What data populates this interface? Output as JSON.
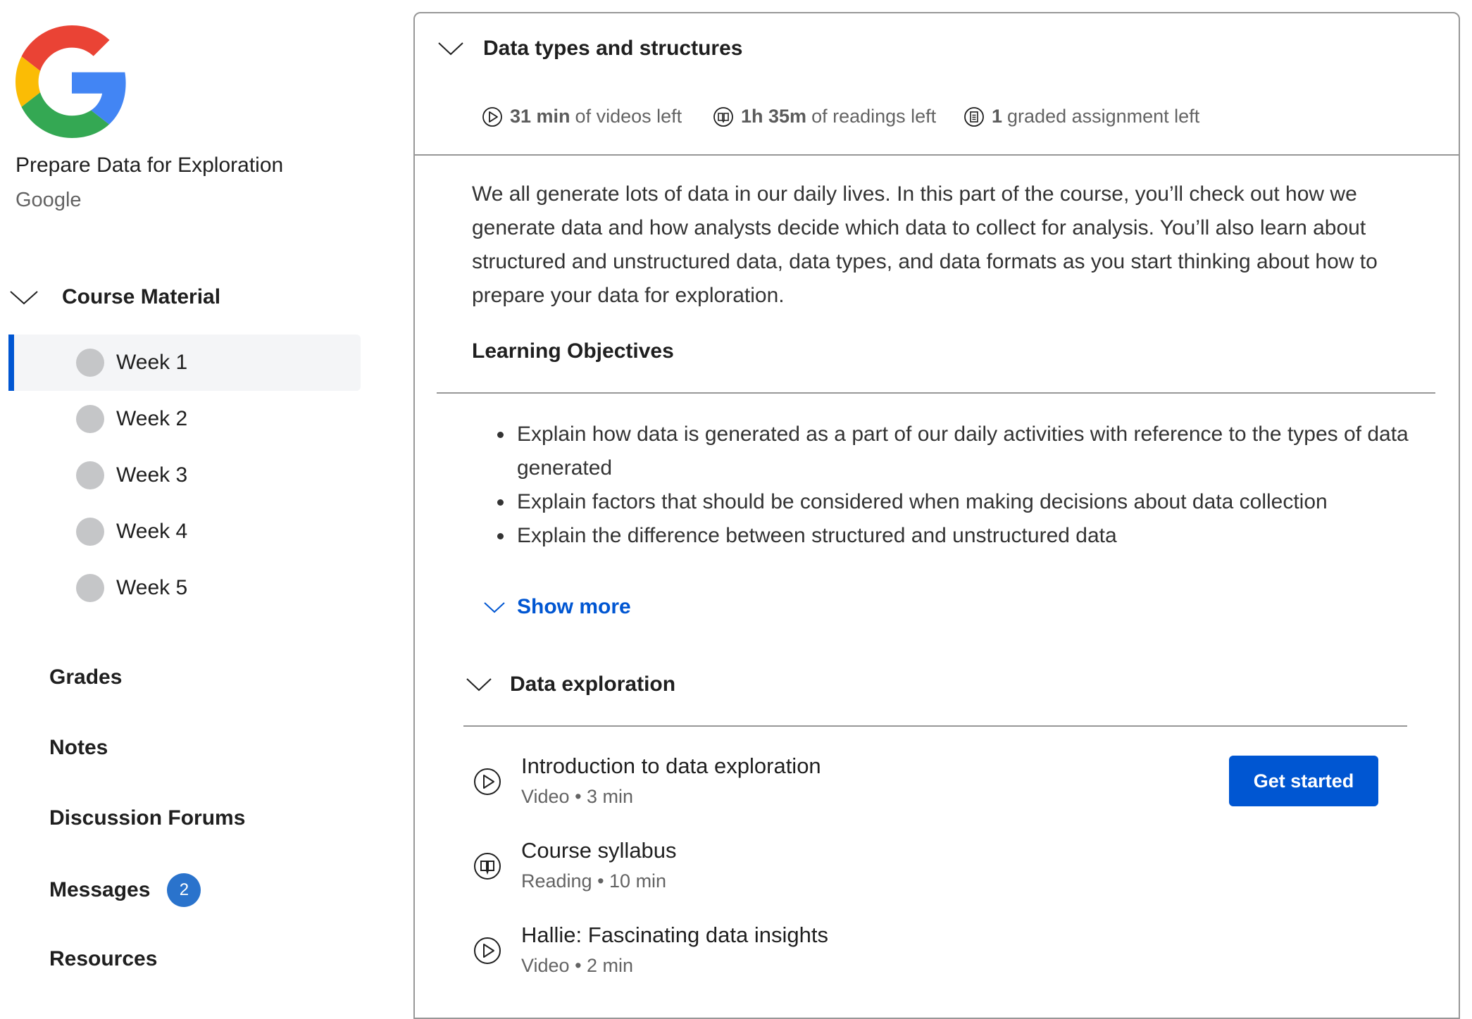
{
  "course": {
    "title": "Prepare Data for Exploration",
    "partner": "Google",
    "logo_icon": "google-g-logo",
    "brand_colors": {
      "red": "#ea4335",
      "yellow": "#fbbc05",
      "green": "#34a853",
      "blue": "#4285f4"
    }
  },
  "sidebar": {
    "course_material_label": "Course Material",
    "weeks": [
      {
        "label": "Week 1",
        "active": true
      },
      {
        "label": "Week 2",
        "active": false
      },
      {
        "label": "Week 3",
        "active": false
      },
      {
        "label": "Week 4",
        "active": false
      },
      {
        "label": "Week 5",
        "active": false
      }
    ],
    "links": [
      {
        "label": "Grades"
      },
      {
        "label": "Notes"
      },
      {
        "label": "Discussion Forums"
      },
      {
        "label": "Messages",
        "badge": "2"
      },
      {
        "label": "Resources"
      }
    ],
    "accent_color": "#0056d2"
  },
  "module": {
    "title": "Data types and structures",
    "stats": [
      {
        "icon": "video-play-icon",
        "value": "31 min",
        "text": "of videos left"
      },
      {
        "icon": "reading-book-icon",
        "value": "1h 35m",
        "text": "of readings left"
      },
      {
        "icon": "assignment-icon",
        "value": "1",
        "text": "graded assignment left"
      }
    ],
    "description": "We all generate lots of data in our daily lives. In this part of the course, you’ll check out how we generate data and how analysts decide which data to collect for analysis. You’ll also learn about structured and unstructured data, data types, and data formats as you start thinking about how to prepare your data for exploration.",
    "learning_objectives_heading": "Learning Objectives",
    "learning_objectives": [
      "Explain how data is generated as a part of our daily activities with reference to the types of data generated",
      "Explain factors that should be considered when making decisions about data collection",
      "Explain the difference between structured and unstructured data"
    ],
    "show_more_label": "Show more"
  },
  "lesson": {
    "title": "Data exploration",
    "items": [
      {
        "icon": "video-play-icon",
        "title": "Introduction to data exploration",
        "meta": "Video • 3 min"
      },
      {
        "icon": "reading-book-icon",
        "title": "Course syllabus",
        "meta": "Reading • 10 min"
      },
      {
        "icon": "video-play-icon",
        "title": "Hallie: Fascinating data insights",
        "meta": "Video • 2 min"
      }
    ],
    "get_started_label": "Get started"
  }
}
